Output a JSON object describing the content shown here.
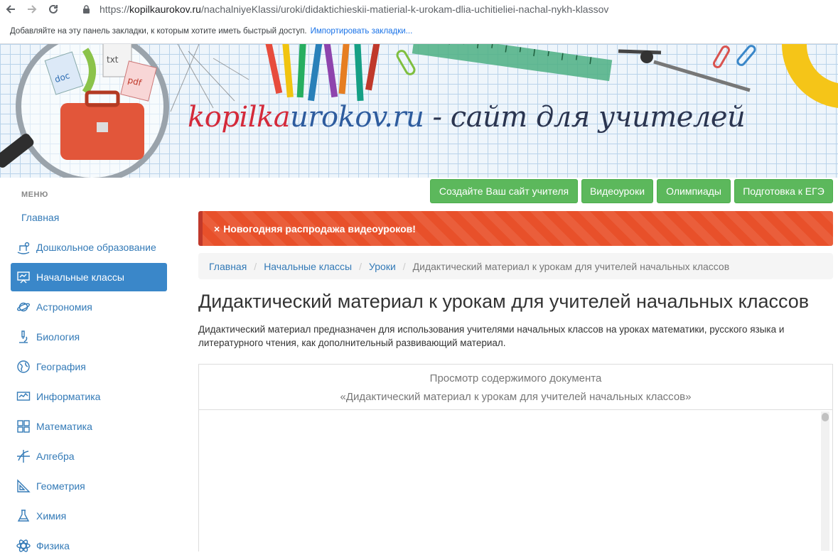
{
  "browser": {
    "url_host": "kopilkaurokov.ru",
    "url_prefix": "https://",
    "url_path": "/nachalniyeKlassi/uroki/didaktichieskii-matierial-k-urokam-dlia-uchitieliei-nachal-nykh-klassov",
    "bookmarks_hint": "Добавляйте на эту панель закладки, к которым хотите иметь быстрый доступ.",
    "bookmarks_import": "Импортировать закладки..."
  },
  "header": {
    "title_red": "kopilka",
    "title_blue": "urokov.ru",
    "title_rest": " - сайт для учителей"
  },
  "nav_buttons": [
    {
      "label": "Создайте Ваш сайт учителя"
    },
    {
      "label": "Видеоуроки"
    },
    {
      "label": "Олимпиады"
    },
    {
      "label": "Подготовка к ЕГЭ"
    }
  ],
  "sidebar": {
    "menu_label": "МЕНЮ",
    "items": [
      {
        "label": "Главная",
        "icon": ""
      },
      {
        "label": "Дошкольное образование",
        "icon": "rocking-horse-icon"
      },
      {
        "label": "Начальные классы",
        "icon": "blackboard-icon"
      },
      {
        "label": "Астрономия",
        "icon": "planet-icon"
      },
      {
        "label": "Биология",
        "icon": "microscope-icon"
      },
      {
        "label": "География",
        "icon": "globe-icon"
      },
      {
        "label": "Информатика",
        "icon": "monitor-icon"
      },
      {
        "label": "Математика",
        "icon": "calculator-icon"
      },
      {
        "label": "Алгебра",
        "icon": "graph-axes-icon"
      },
      {
        "label": "Геометрия",
        "icon": "triangle-ruler-icon"
      },
      {
        "label": "Химия",
        "icon": "flask-icon"
      },
      {
        "label": "Физика",
        "icon": "atom-icon"
      }
    ]
  },
  "alert": {
    "close": "×",
    "text": "Новогодняя распродажа видеоуроков!"
  },
  "breadcrumb": {
    "items": [
      "Главная",
      "Начальные классы",
      "Уроки"
    ],
    "current": "Дидактический материал к урокам для учителей начальных классов",
    "separator": "/"
  },
  "main": {
    "title": "Дидактический материал к урокам для учителей начальных классов",
    "description": "Дидактический материал предназначен для использования учителями начальных классов на уроках математики, русского языка и литературного чтения, как  дополнительный  развивающий материал."
  },
  "document_preview": {
    "heading": "Просмотр содержимого документа",
    "doc_title": "«Дидактический материал к урокам для учителей начальных классов»"
  },
  "colors": {
    "link": "#337ab7",
    "active_menu": "#3a87c9",
    "button_green": "#5cb85c",
    "alert_orange": "#e8502a"
  }
}
